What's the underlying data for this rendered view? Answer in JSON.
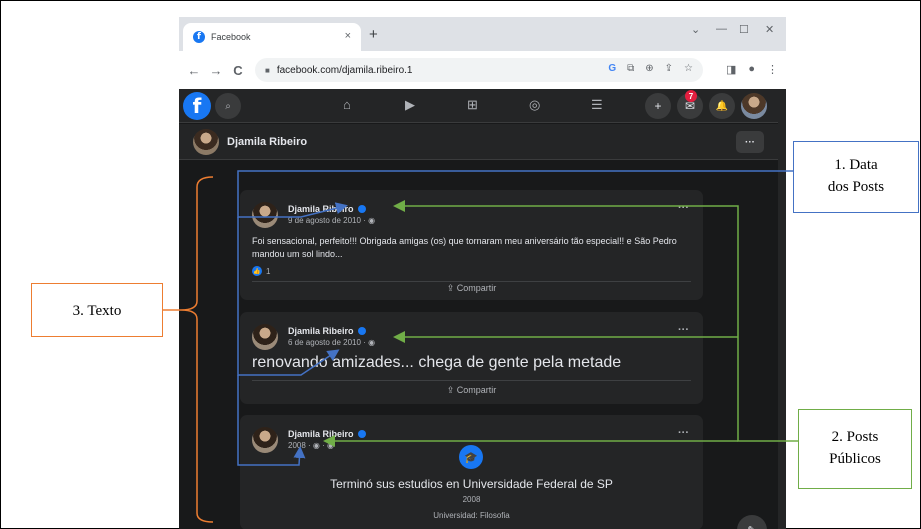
{
  "browser": {
    "tab_title": "Facebook",
    "tab_close": "×",
    "new_tab": "+",
    "window_controls": [
      "⌄",
      "—",
      "☐",
      "✕"
    ],
    "url": "facebook.com/djamila.ribeiro.1",
    "nav": {
      "back": "←",
      "forward": "→",
      "reload": "C"
    },
    "omni_icons": [
      "G",
      "⧉",
      "⊕",
      "⇪",
      "☆"
    ],
    "toolbar_right": [
      "◨",
      "●",
      "⋮"
    ]
  },
  "fb_header": {
    "logo": "f",
    "search_icon": "⌕",
    "center_icons": [
      "⌂",
      "▶",
      "⊞",
      "◎",
      "☰"
    ],
    "plus": "+",
    "messenger_badge": "7",
    "messenger_icon": "✉",
    "bell_icon": "🔔"
  },
  "profile_bar": {
    "name": "Djamila Ribeiro",
    "more": "···"
  },
  "posts": [
    {
      "author": "Djamila Ribeiro",
      "date": "9 de agosto de 2010 · ◉",
      "text": "Foi sensacional, perfeito!!! Obrigada amigas (os) que tornaram meu aniversário tão especial!! e São Pedro mandou um sol lindo...",
      "likes": "1",
      "share": "⇪ Compartir",
      "more": "···"
    },
    {
      "author": "Djamila Ribeiro",
      "date": "6 de agosto de 2010 · ◉",
      "text": "renovando amizades... chega de gente pela metade",
      "share": "⇪ Compartir",
      "more": "···"
    },
    {
      "author": "Djamila Ribeiro",
      "date": "2008 · ◉ · ◉",
      "edu_title": "Terminó sus estudios en Universidade Federal de SP",
      "edu_year": "2008",
      "edu_sub": "Universidad: Filosofia",
      "more": "···"
    }
  ],
  "annotations": {
    "data_line1": "1. Data",
    "data_line2": "dos Posts",
    "publicos_line1": "2. Posts",
    "publicos_line2": "Públicos",
    "texto": "3. Texto"
  },
  "colors": {
    "fb_blue": "#1877f2",
    "arrow_blue": "#4472c4",
    "arrow_green": "#70ad47",
    "brace_orange": "#ed7d31",
    "dark_bg": "#18191a",
    "card_bg": "#242526"
  }
}
